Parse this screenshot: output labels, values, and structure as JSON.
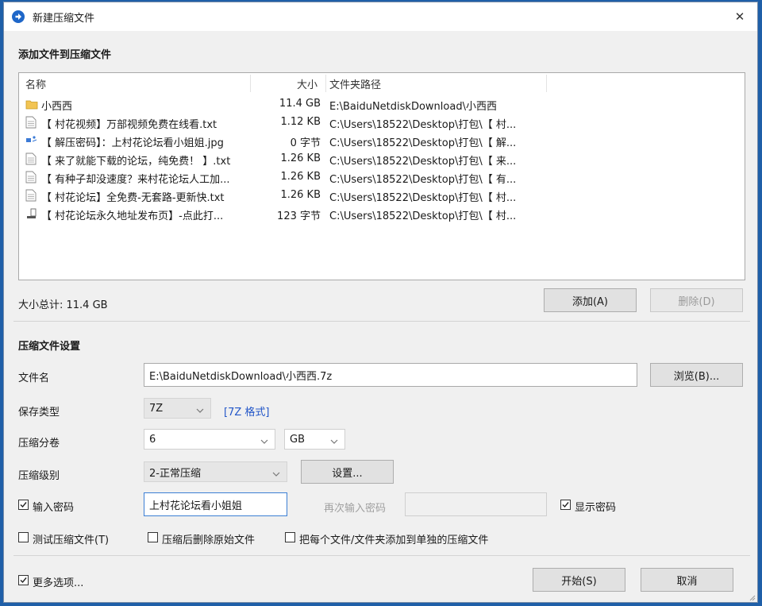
{
  "window": {
    "title": "新建压缩文件",
    "close_symbol": "✕"
  },
  "add_section": {
    "title": "添加文件到压缩文件"
  },
  "file_list": {
    "columns": {
      "name": "名称",
      "size": "大小",
      "path": "文件夹路径"
    },
    "rows": [
      {
        "icon": "folder-icon",
        "name": "小西西",
        "size": "11.4 GB",
        "path": "E:\\BaiduNetdiskDownload\\小西西"
      },
      {
        "icon": "text-file-icon",
        "name": "【 村花视频】万部视频免费在线看.txt",
        "size": "1.12 KB",
        "path": "C:\\Users\\18522\\Desktop\\打包\\【 村..."
      },
      {
        "icon": "image-file-icon",
        "name": "【 解压密码】：上村花论坛看小姐姐.jpg",
        "size": "0 字节",
        "path": "C:\\Users\\18522\\Desktop\\打包\\【 解..."
      },
      {
        "icon": "text-file-icon",
        "name": "【 来了就能下载的论坛，纯免费！ 】.txt",
        "size": "1.26 KB",
        "path": "C:\\Users\\18522\\Desktop\\打包\\【 来..."
      },
      {
        "icon": "text-file-icon",
        "name": "【 有种子却没速度？来村花论坛人工加...",
        "size": "1.26 KB",
        "path": "C:\\Users\\18522\\Desktop\\打包\\【 有..."
      },
      {
        "icon": "text-file-icon",
        "name": "【 村花论坛】全免费-无套路-更新快.txt",
        "size": "1.26 KB",
        "path": "C:\\Users\\18522\\Desktop\\打包\\【 村..."
      },
      {
        "icon": "shortcut-file-icon",
        "name": "【 村花论坛永久地址发布页】-点此打...",
        "size": "123 字节",
        "path": "C:\\Users\\18522\\Desktop\\打包\\【 村..."
      }
    ]
  },
  "total_size": "大小总计: 11.4 GB",
  "buttons": {
    "add": "添加(A)",
    "delete": "删除(D)",
    "browse": "浏览(B)...",
    "settings": "设置...",
    "start": "开始(S)",
    "cancel": "取消"
  },
  "settings_section": {
    "title": "压缩文件设置",
    "filename_label": "文件名",
    "filename_value": "E:\\BaiduNetdiskDownload\\小西西.7z",
    "save_type_label": "保存类型",
    "save_type_value": "7Z",
    "format_link": "[7Z 格式]",
    "split_label": "压缩分卷",
    "split_value": "6",
    "split_unit": "GB",
    "level_label": "压缩级别",
    "level_value": "2-正常压缩",
    "password_label": "输入密码",
    "password_value": "上村花论坛看小姐姐",
    "reenter_label": "再次输入密码",
    "reenter_value": "",
    "show_password_label": "显示密码",
    "test_label": "测试压缩文件(T)",
    "delete_after_label": "压缩后删除原始文件",
    "separate_label": "把每个文件/文件夹添加到单独的压缩文件",
    "more_options_label": "更多选项..."
  },
  "checks": {
    "password": true,
    "show_password": true,
    "test": false,
    "delete_after": false,
    "separate": false,
    "more_options": true
  }
}
